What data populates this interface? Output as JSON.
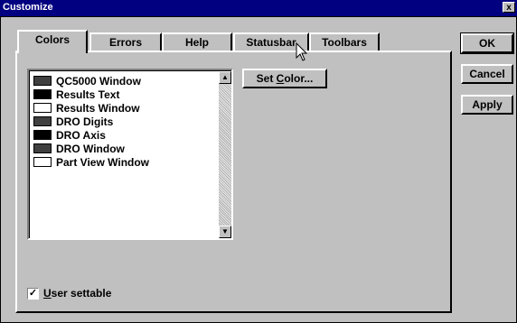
{
  "window": {
    "title": "Customize",
    "close_glyph": "x"
  },
  "tabs": [
    {
      "label": "Colors",
      "active": true
    },
    {
      "label": "Errors",
      "active": false
    },
    {
      "label": "Help",
      "active": false
    },
    {
      "label": "Statusbar",
      "active": false
    },
    {
      "label": "Toolbars",
      "active": false
    }
  ],
  "color_list": {
    "items": [
      {
        "label": "QC5000 Window",
        "swatch": "#404040"
      },
      {
        "label": "Results Text",
        "swatch": "#000000"
      },
      {
        "label": "Results Window",
        "swatch": "#ffffff"
      },
      {
        "label": "DRO Digits",
        "swatch": "#404040"
      },
      {
        "label": "DRO Axis",
        "swatch": "#000000"
      },
      {
        "label": "DRO Window",
        "swatch": "#404040"
      },
      {
        "label": "Part View Window",
        "swatch": "#ffffff"
      }
    ]
  },
  "set_color_button": {
    "label": "Set Color..."
  },
  "user_settable": {
    "label": "User settable",
    "checked": true
  },
  "buttons": {
    "ok": "OK",
    "cancel": "Cancel",
    "apply": "Apply"
  }
}
